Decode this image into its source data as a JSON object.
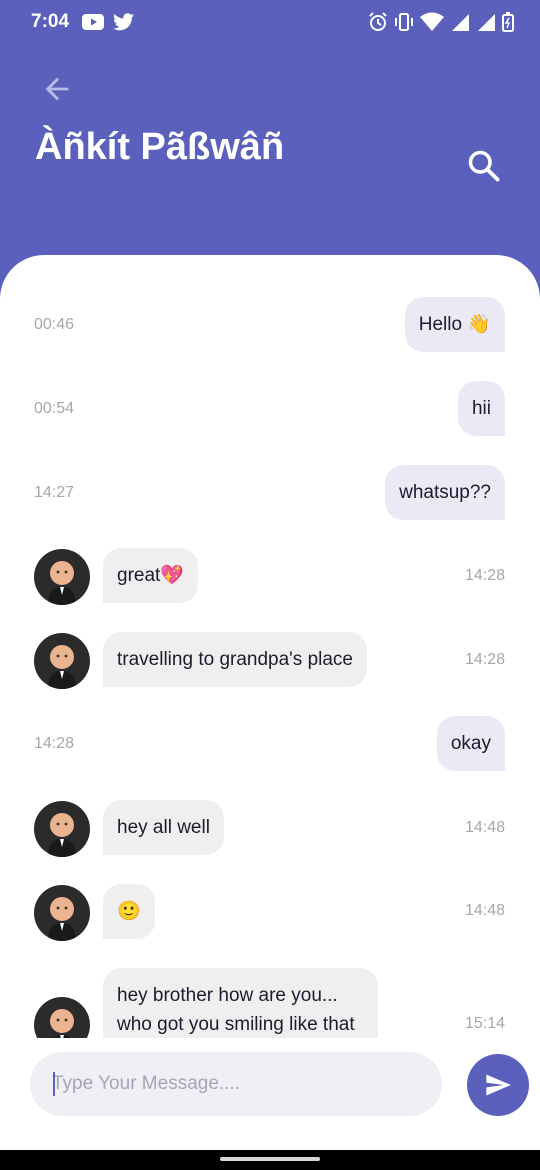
{
  "status_bar": {
    "time": "7:04"
  },
  "header": {
    "title": "Àñkít Pãßwâñ"
  },
  "messages": [
    {
      "dir": "out",
      "text": "Hello 👋",
      "time": "00:46"
    },
    {
      "dir": "out",
      "text": "hii",
      "time": "00:54"
    },
    {
      "dir": "out",
      "text": "whatsup??",
      "time": "14:27"
    },
    {
      "dir": "in",
      "text": "great💖",
      "time": "14:28"
    },
    {
      "dir": "in",
      "text": "travelling to grandpa's place",
      "time": "14:28"
    },
    {
      "dir": "out",
      "text": "okay",
      "time": "14:28"
    },
    {
      "dir": "in",
      "text": "hey all well",
      "time": "14:48"
    },
    {
      "dir": "in",
      "text": "🙂",
      "time": "14:48"
    },
    {
      "dir": "in",
      "text": "hey brother how are you... who got you smiling like that",
      "time": "15:14"
    }
  ],
  "composer": {
    "placeholder": "Type Your Message...."
  },
  "colors": {
    "primary": "#5a60bb",
    "bubble_out": "#eaeaf6",
    "bubble_in": "#efefef"
  }
}
